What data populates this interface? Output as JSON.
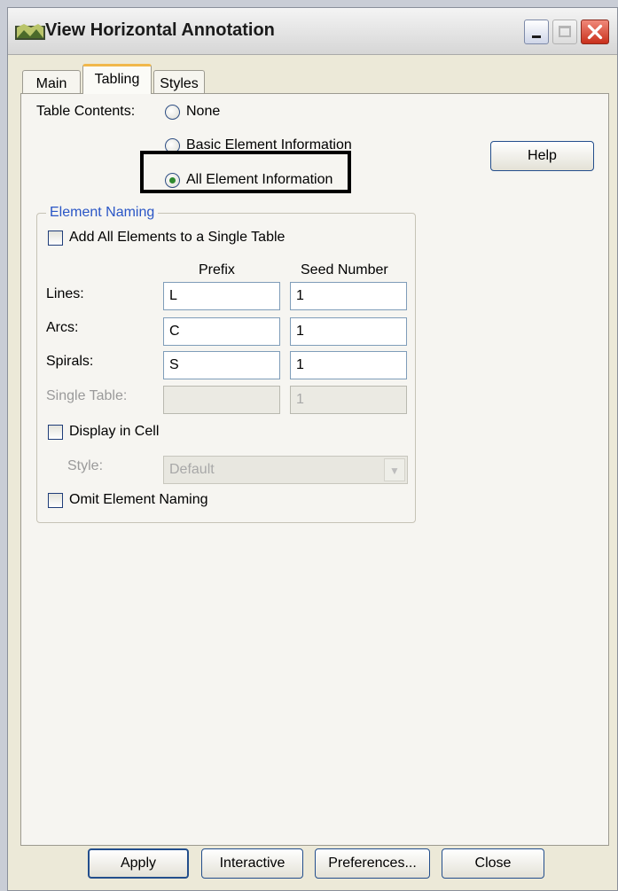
{
  "window": {
    "title": "View Horizontal Annotation",
    "controls": [
      "minimize-icon",
      "maximize-icon",
      "close-icon"
    ]
  },
  "tabs": [
    {
      "label": "Main",
      "active": false
    },
    {
      "label": "Tabling",
      "active": true
    },
    {
      "label": "Styles",
      "active": false
    }
  ],
  "tabling": {
    "table_contents_label": "Table Contents:",
    "options": [
      {
        "label": "None",
        "selected": false
      },
      {
        "label": "Basic Element Information",
        "selected": false
      },
      {
        "label": "All Element Information",
        "selected": true
      }
    ],
    "help_label": "Help"
  },
  "element_naming": {
    "legend": "Element Naming",
    "add_all_label": "Add All Elements to a Single Table",
    "prefix_header": "Prefix",
    "seed_header": "Seed Number",
    "rows": [
      {
        "label": "Lines:",
        "prefix": "L",
        "seed": "1",
        "enabled": true
      },
      {
        "label": "Arcs:",
        "prefix": "C",
        "seed": "1",
        "enabled": true
      },
      {
        "label": "Spirals:",
        "prefix": "S",
        "seed": "1",
        "enabled": true
      },
      {
        "label": "Single Table:",
        "prefix": "",
        "seed": "1",
        "enabled": false
      }
    ],
    "display_in_cell_label": "Display in Cell",
    "style_label": "Style:",
    "style_value": "Default",
    "omit_label": "Omit Element Naming"
  },
  "buttons": {
    "apply": "Apply",
    "interactive": "Interactive",
    "preferences": "Preferences...",
    "close": "Close"
  },
  "colors": {
    "accent_tab": "#f1b84b",
    "legend_text": "#2a56c6",
    "radio_dot": "#2f8a2f",
    "close_button": "#c9301c"
  }
}
